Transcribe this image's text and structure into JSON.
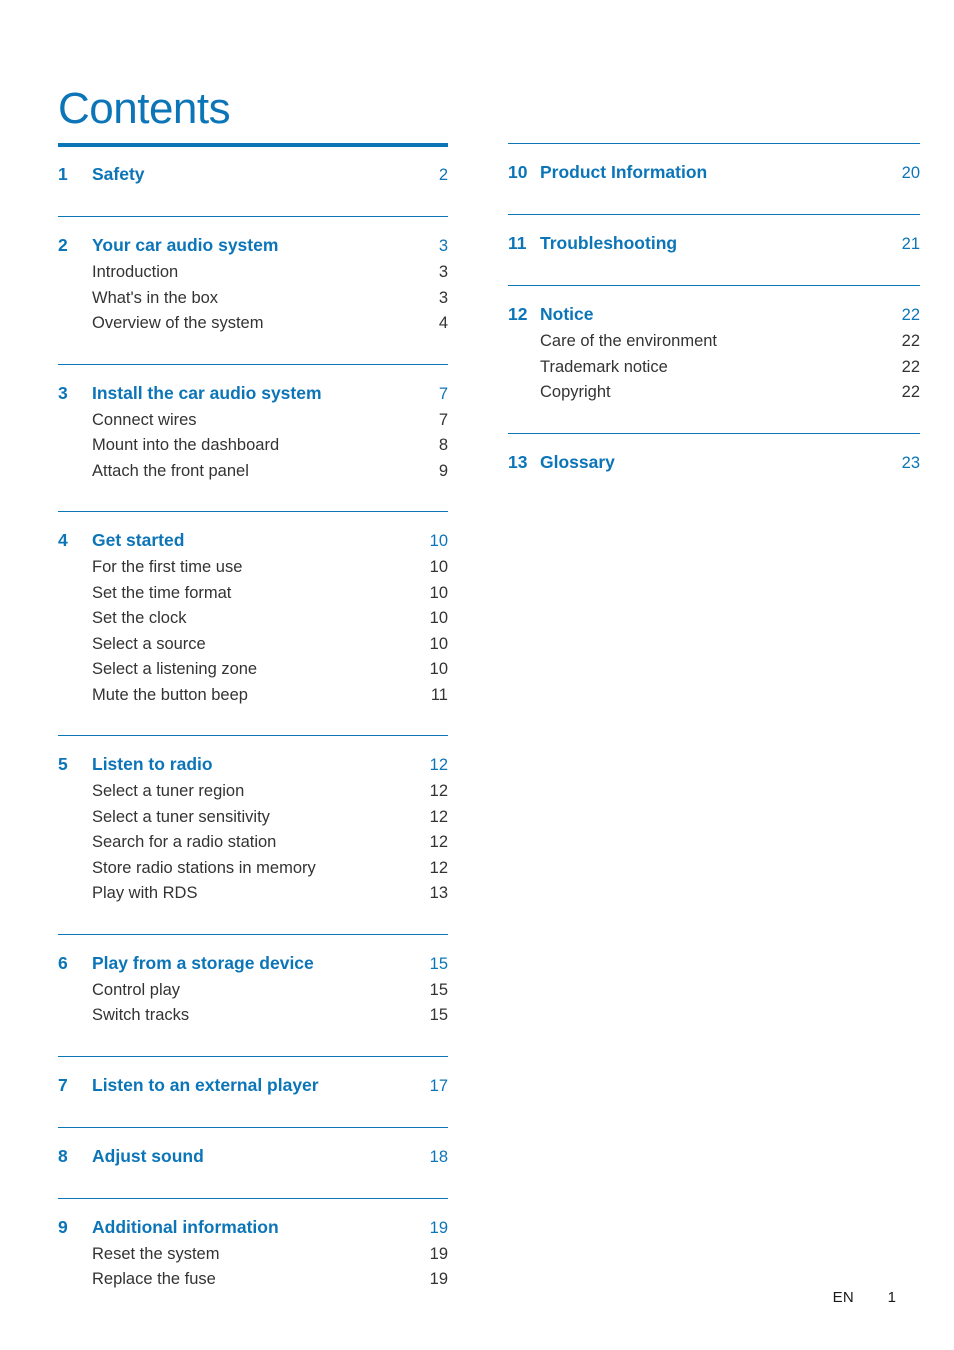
{
  "document": {
    "title": "Contents",
    "accent_color": "#0c75b8",
    "body_text_color": "#333333"
  },
  "footer": {
    "language": "EN",
    "page_number": "1"
  },
  "toc": {
    "left_column": [
      {
        "rule": "thick",
        "number": "1",
        "title": "Safety",
        "page": "2",
        "subitems": []
      },
      {
        "rule": "thin",
        "number": "2",
        "title": "Your car audio system",
        "page": "3",
        "subitems": [
          {
            "title": "Introduction",
            "page": "3"
          },
          {
            "title": "What's in the box",
            "page": "3"
          },
          {
            "title": "Overview of the system",
            "page": "4"
          }
        ]
      },
      {
        "rule": "thin",
        "number": "3",
        "title": "Install the car audio system",
        "page": "7",
        "subitems": [
          {
            "title": "Connect wires",
            "page": "7"
          },
          {
            "title": "Mount into the dashboard",
            "page": "8"
          },
          {
            "title": "Attach the front panel",
            "page": "9"
          }
        ]
      },
      {
        "rule": "thin",
        "number": "4",
        "title": "Get started",
        "page": "10",
        "subitems": [
          {
            "title": "For the first time use",
            "page": "10"
          },
          {
            "title": "Set the time format",
            "page": "10"
          },
          {
            "title": "Set the clock",
            "page": "10"
          },
          {
            "title": "Select a source",
            "page": "10"
          },
          {
            "title": "Select a listening zone",
            "page": "10"
          },
          {
            "title": "Mute the button beep",
            "page": "11"
          }
        ]
      },
      {
        "rule": "thin",
        "number": "5",
        "title": "Listen to radio",
        "page": "12",
        "subitems": [
          {
            "title": "Select a tuner region",
            "page": "12"
          },
          {
            "title": "Select a tuner sensitivity",
            "page": "12"
          },
          {
            "title": "Search for a radio station",
            "page": "12"
          },
          {
            "title": "Store radio stations in memory",
            "page": "12"
          },
          {
            "title": "Play with RDS",
            "page": "13"
          }
        ]
      },
      {
        "rule": "thin",
        "number": "6",
        "title": "Play from a storage device",
        "page": "15",
        "subitems": [
          {
            "title": "Control play",
            "page": "15"
          },
          {
            "title": "Switch tracks",
            "page": "15"
          }
        ]
      },
      {
        "rule": "thin",
        "number": "7",
        "title": "Listen to an external player",
        "page": "17",
        "subitems": []
      },
      {
        "rule": "thin",
        "number": "8",
        "title": "Adjust sound",
        "page": "18",
        "subitems": []
      },
      {
        "rule": "thin",
        "number": "9",
        "title": "Additional information",
        "page": "19",
        "subitems": [
          {
            "title": "Reset the system",
            "page": "19"
          },
          {
            "title": "Replace the fuse",
            "page": "19"
          }
        ]
      }
    ],
    "right_column": [
      {
        "rule": "thin",
        "number": "10",
        "title": "Product Information",
        "page": "20",
        "subitems": []
      },
      {
        "rule": "thin",
        "number": "11",
        "title": "Troubleshooting",
        "page": "21",
        "subitems": []
      },
      {
        "rule": "thin",
        "number": "12",
        "title": "Notice",
        "page": "22",
        "subitems": [
          {
            "title": "Care of the environment",
            "page": "22"
          },
          {
            "title": "Trademark notice",
            "page": "22"
          },
          {
            "title": "Copyright",
            "page": "22"
          }
        ]
      },
      {
        "rule": "thin",
        "number": "13",
        "title": "Glossary",
        "page": "23",
        "subitems": []
      }
    ]
  }
}
